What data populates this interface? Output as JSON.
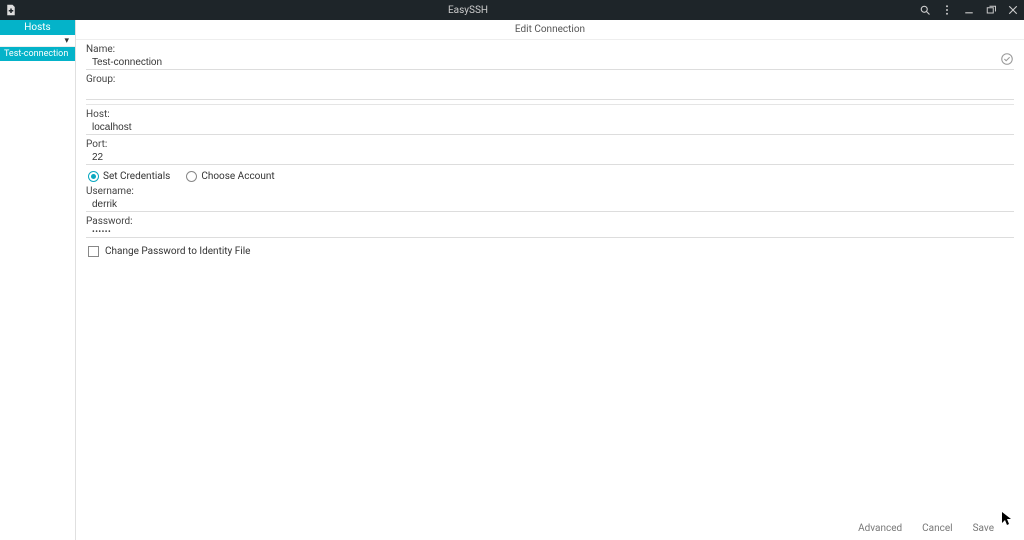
{
  "app": {
    "title": "EasySSH"
  },
  "titlebar": {
    "new_icon": "new-file-icon",
    "search_icon": "search-icon",
    "menu_icon": "more-icon",
    "min_icon": "minimize-icon",
    "restore_icon": "restore-icon",
    "close_icon": "close-icon"
  },
  "sidebar": {
    "header_label": "Hosts",
    "dropdown_caret": "▾",
    "items": [
      {
        "label": "Test-connection"
      }
    ]
  },
  "dialog": {
    "title": "Edit Connection",
    "fields": {
      "name_label": "Name:",
      "name_value": "Test-connection",
      "group_label": "Group:",
      "group_value": "",
      "host_label": "Host:",
      "host_value": "localhost",
      "port_label": "Port:",
      "port_value": "22",
      "username_label": "Username:",
      "username_value": "derrik",
      "password_label": "Password:",
      "password_value": "••••••"
    },
    "radio": {
      "set_credentials": "Set Credentials",
      "choose_account": "Choose Account"
    },
    "checkbox": {
      "identity_file": "Change Password to Identity File"
    }
  },
  "footer": {
    "advanced": "Advanced",
    "cancel": "Cancel",
    "save": "Save"
  }
}
